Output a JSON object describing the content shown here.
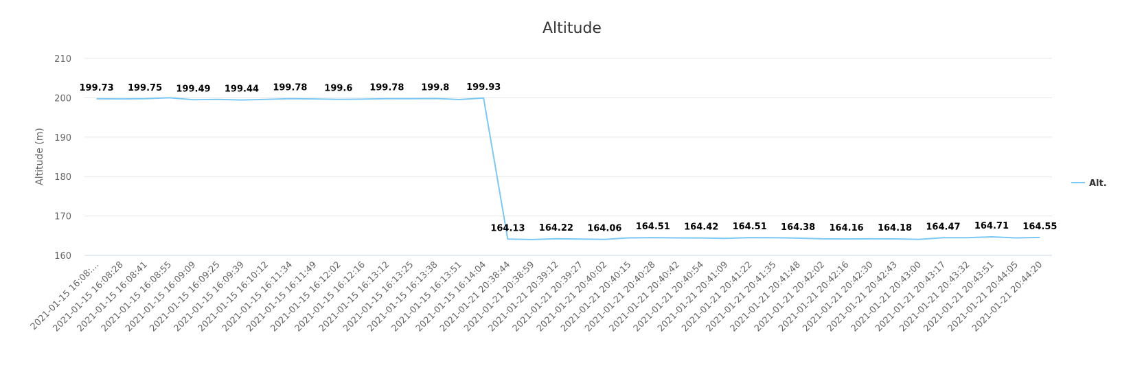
{
  "chart_data": {
    "type": "line",
    "title": "Altitude",
    "ylabel": "Altitude (m)",
    "xlabel": "",
    "ylim": [
      160,
      210
    ],
    "yticks": [
      "160",
      "170",
      "180",
      "190",
      "200",
      "210"
    ],
    "grid": true,
    "legend_position": "right",
    "categories": [
      "2021-01-15 16:08:…",
      "2021-01-15 16:08:28",
      "2021-01-15 16:08:41",
      "2021-01-15 16:08:55",
      "2021-01-15 16:09:09",
      "2021-01-15 16:09:25",
      "2021-01-15 16:09:39",
      "2021-01-15 16:10:12",
      "2021-01-15 16:11:34",
      "2021-01-15 16:11:49",
      "2021-01-15 16:12:02",
      "2021-01-15 16:12:16",
      "2021-01-15 16:13:12",
      "2021-01-15 16:13:25",
      "2021-01-15 16:13:38",
      "2021-01-15 16:13:51",
      "2021-01-15 16:14:04",
      "2021-01-21 20:38:44",
      "2021-01-21 20:38:59",
      "2021-01-21 20:39:12",
      "2021-01-21 20:39:27",
      "2021-01-21 20:40:02",
      "2021-01-21 20:40:15",
      "2021-01-21 20:40:28",
      "2021-01-21 20:40:42",
      "2021-01-21 20:40:54",
      "2021-01-21 20:41:09",
      "2021-01-21 20:41:22",
      "2021-01-21 20:41:35",
      "2021-01-21 20:41:48",
      "2021-01-21 20:42:02",
      "2021-01-21 20:42:16",
      "2021-01-21 20:42:30",
      "2021-01-21 20:42:43",
      "2021-01-21 20:43:00",
      "2021-01-21 20:43:17",
      "2021-01-21 20:43:32",
      "2021-01-21 20:43:51",
      "2021-01-21 20:44:05",
      "2021-01-21 20:44:20"
    ],
    "series": [
      {
        "name": "Alt.",
        "color": "#7cc8f4",
        "values": [
          199.73,
          199.7,
          199.75,
          200.0,
          199.49,
          199.6,
          199.44,
          199.6,
          199.78,
          199.7,
          199.6,
          199.65,
          199.78,
          199.75,
          199.8,
          199.55,
          199.93,
          164.13,
          164.0,
          164.22,
          164.15,
          164.06,
          164.45,
          164.51,
          164.45,
          164.42,
          164.3,
          164.51,
          164.5,
          164.38,
          164.2,
          164.16,
          164.2,
          164.18,
          164.05,
          164.47,
          164.5,
          164.71,
          164.45,
          164.55
        ],
        "data_labels": [
          {
            "index": 0,
            "text": "199.73"
          },
          {
            "index": 2,
            "text": "199.75"
          },
          {
            "index": 4,
            "text": "199.49"
          },
          {
            "index": 6,
            "text": "199.44"
          },
          {
            "index": 8,
            "text": "199.78"
          },
          {
            "index": 10,
            "text": "199.6"
          },
          {
            "index": 12,
            "text": "199.78"
          },
          {
            "index": 14,
            "text": "199.8"
          },
          {
            "index": 16,
            "text": "199.93"
          },
          {
            "index": 17,
            "text": "164.13"
          },
          {
            "index": 19,
            "text": "164.22"
          },
          {
            "index": 21,
            "text": "164.06"
          },
          {
            "index": 23,
            "text": "164.51"
          },
          {
            "index": 25,
            "text": "164.42"
          },
          {
            "index": 27,
            "text": "164.51"
          },
          {
            "index": 29,
            "text": "164.38"
          },
          {
            "index": 31,
            "text": "164.16"
          },
          {
            "index": 33,
            "text": "164.18"
          },
          {
            "index": 35,
            "text": "164.47"
          },
          {
            "index": 37,
            "text": "164.71"
          },
          {
            "index": 39,
            "text": "164.55"
          }
        ]
      }
    ]
  }
}
